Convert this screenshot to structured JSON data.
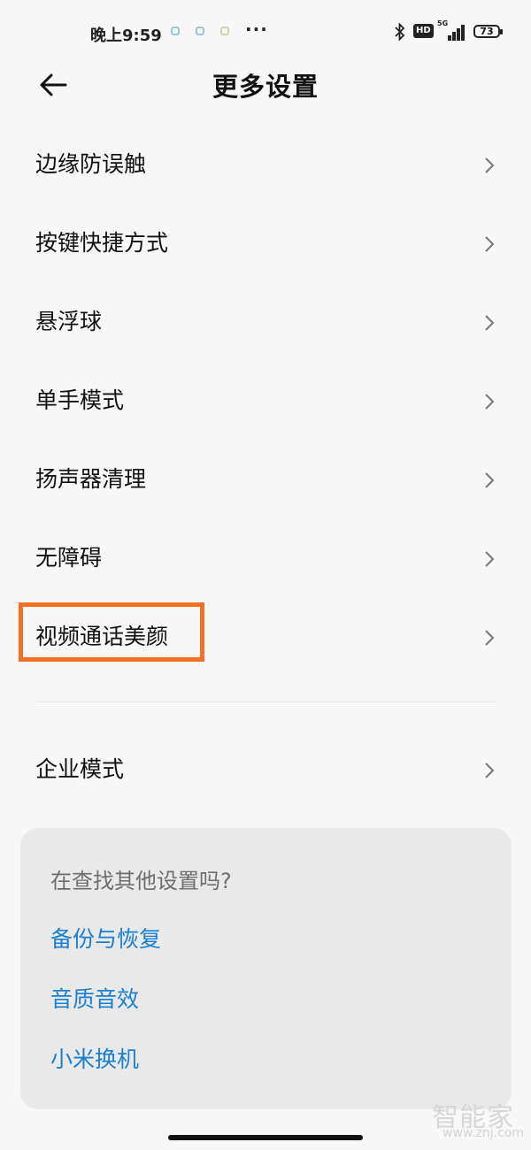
{
  "status_bar": {
    "time": "晚上9:59",
    "more": "···",
    "hd": "HD",
    "network": "5G",
    "battery": "73"
  },
  "header": {
    "title": "更多设置"
  },
  "menu": {
    "items": [
      {
        "label": "边缘防误触"
      },
      {
        "label": "按键快捷方式"
      },
      {
        "label": "悬浮球"
      },
      {
        "label": "单手模式"
      },
      {
        "label": "扬声器清理"
      },
      {
        "label": "无障碍"
      },
      {
        "label": "视频通话美颜",
        "highlighted": true
      },
      {
        "label": "企业模式"
      }
    ]
  },
  "suggestions": {
    "title": "在查找其他设置吗?",
    "links": [
      {
        "label": "备份与恢复"
      },
      {
        "label": "音质音效"
      },
      {
        "label": "小米换机"
      }
    ]
  },
  "watermark": {
    "brand": "智能家",
    "url": "www.znj.com"
  },
  "colors": {
    "background": "#f7f7f7",
    "link": "#1a7fcf",
    "highlight": "#f26f25",
    "card": "#e9e9e9"
  }
}
